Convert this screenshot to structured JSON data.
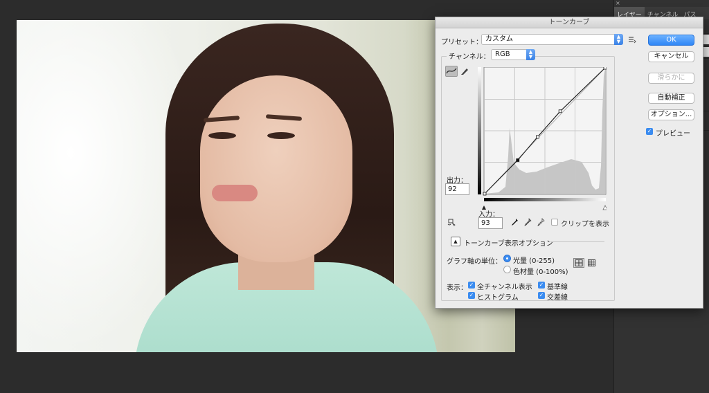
{
  "dialog": {
    "title": "トーンカーブ",
    "preset_label": "プリセット：",
    "preset_value": "カスタム",
    "channel_label": "チャンネル：",
    "channel_value": "RGB",
    "output_label": "出力：",
    "output_value": "92",
    "input_label": "入力：",
    "input_value": "93",
    "clip_label": "クリップを表示",
    "display_options_label": "トーンカーブ表示オプション",
    "graph_units_label": "グラフ軸の単位：",
    "units": [
      {
        "label": "光量 (0-255)",
        "selected": true
      },
      {
        "label": "色材量 (0-100%)",
        "selected": false
      }
    ],
    "show_label": "表示：",
    "show_options": [
      {
        "label": "全チャンネル表示",
        "checked": true
      },
      {
        "label": "基準線",
        "checked": true
      },
      {
        "label": "ヒストグラム",
        "checked": true
      },
      {
        "label": "交差線",
        "checked": true
      }
    ],
    "buttons": {
      "ok": "OK",
      "cancel": "キャンセル",
      "smooth": "滑らかに",
      "auto": "自動補正",
      "options": "オプション..."
    },
    "preview_label": "プレビュー",
    "preview_checked": true
  },
  "curve": {
    "channel": "RGB",
    "points": [
      [
        0,
        0
      ],
      [
        70,
        68
      ],
      [
        112,
        115
      ],
      [
        160,
        167
      ],
      [
        255,
        255
      ]
    ]
  },
  "panel": {
    "tabs": [
      "レイヤー",
      "チャンネル",
      "パス"
    ],
    "close_glyph": "×"
  },
  "icons": {
    "curve_tool": "curve-point-icon",
    "pencil_tool": "pencil-icon",
    "target_adjust": "target-adjust-icon",
    "eyedroppers": [
      "black-point-eyedropper-icon",
      "gray-point-eyedropper-icon",
      "white-point-eyedropper-icon"
    ],
    "preset_menu": "preset-menu-icon",
    "grid_simple": "grid-simple-icon",
    "grid_detailed": "grid-detailed-icon"
  },
  "colors": {
    "accent": "#3b8cf0",
    "dialog_bg": "#ececec",
    "app_bg": "#2c2c2c"
  }
}
